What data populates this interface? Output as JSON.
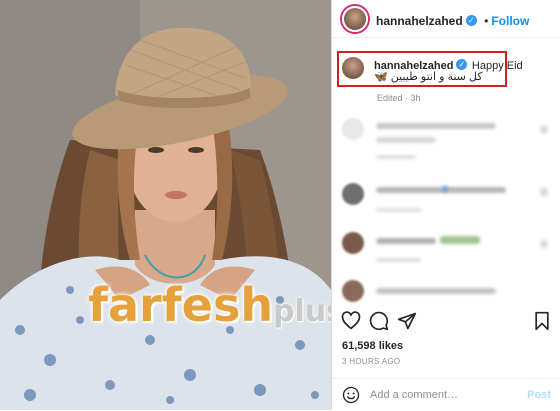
{
  "post": {
    "username": "hannahelzahed",
    "follow_label": "Follow",
    "caption_username": "hannahelzahed",
    "caption_text": "Happy Eid",
    "caption_line2": "كل سنة و انتو طيبين 🦋",
    "edited_label": "Edited · 3h",
    "likes": "61,598 likes",
    "time_ago": "3 HOURS AGO"
  },
  "comment_box": {
    "placeholder": "Add a comment…",
    "post_label": "Post"
  },
  "watermark": {
    "main": "farfesh",
    "sub": "plus.com"
  },
  "colors": {
    "accent": "#0095f6",
    "highlight_border": "#d11f1f",
    "watermark_orange": "#e6a23a",
    "verified": "#3897f0"
  },
  "icons": [
    "heart-icon",
    "comment-icon",
    "share-icon",
    "bookmark-icon",
    "emoji-icon",
    "verified-badge-icon"
  ]
}
